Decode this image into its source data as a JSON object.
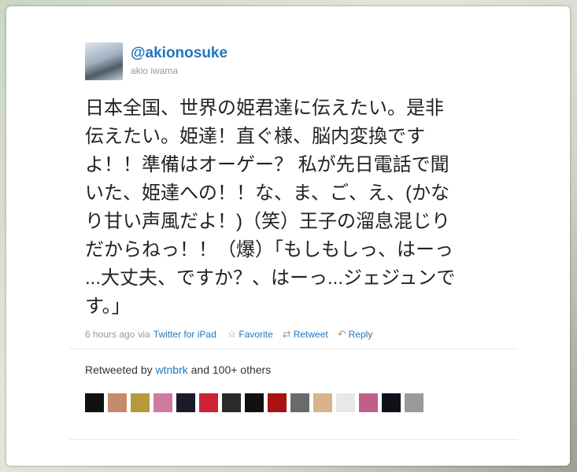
{
  "tweet": {
    "screen_name": "@akionosuke",
    "real_name": "akio iwama",
    "text_lines": [
      "日本全国、世界の姫君達に伝えたい。是非",
      "伝えたい。姫達！直ぐ様、脳内変換です",
      "よ！！準備はオーゲー？ 私が先日電話で聞",
      "いた、姫達への！！な、ま、ご、え、(かな",
      "り甘い声風だよ！)（笑）王子の溜息混じり",
      "だからねっ！！（爆）「もしもしっ、はーっ",
      "...大丈夫、ですか？、はーっ...ジェジュンで",
      "す。」"
    ],
    "timestamp": "6 hours ago",
    "via_label": "via",
    "source": "Twitter for iPad",
    "actions": {
      "favorite": "Favorite",
      "retweet": "Retweet",
      "reply": "Reply"
    },
    "icons": {
      "favorite": "star-icon",
      "retweet": "retweet-icon",
      "reply": "reply-icon"
    }
  },
  "retweets": {
    "prefix": "Retweeted by",
    "user": "wtnbrk",
    "suffix": "and 100+ others",
    "avatar_colors": [
      "#111111",
      "#c58a6a",
      "#b59a3a",
      "#d07aa0",
      "#1a1a2a",
      "#cc2233",
      "#2a2a2a",
      "#111111",
      "#aa1111",
      "#6a6a6a",
      "#d8b48a",
      "#e8e8e8",
      "#c0608a",
      "#101018",
      "#9a9a9a"
    ]
  },
  "colors": {
    "link": "#2276bb",
    "meta": "#999999"
  }
}
